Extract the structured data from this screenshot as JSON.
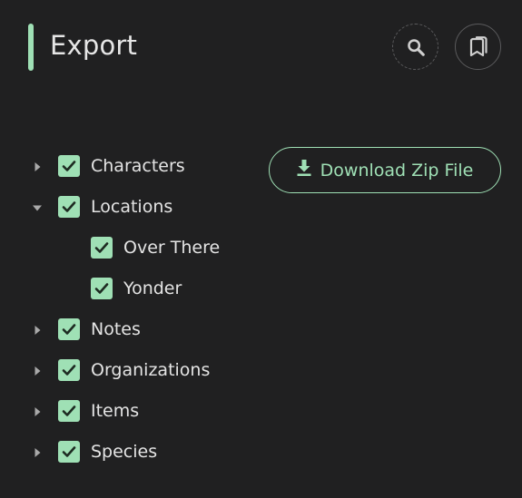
{
  "colors": {
    "accent": "#9fe0b5",
    "background": "#202021",
    "text": "#e4e4e4",
    "icon": "#cfcfcf",
    "check_mark": "#1d2a21"
  },
  "header": {
    "title": "Export",
    "search_icon": "search-icon",
    "bookmark_icon": "bookmarks-icon"
  },
  "download": {
    "label": "Download Zip File",
    "icon": "download-icon"
  },
  "tree": [
    {
      "label": "Characters",
      "checked": true,
      "expanded": false,
      "level": 0
    },
    {
      "label": "Locations",
      "checked": true,
      "expanded": true,
      "level": 0
    },
    {
      "label": "Over There",
      "checked": true,
      "level": 1
    },
    {
      "label": "Yonder",
      "checked": true,
      "level": 1
    },
    {
      "label": "Notes",
      "checked": true,
      "expanded": false,
      "level": 0
    },
    {
      "label": "Organizations",
      "checked": true,
      "expanded": false,
      "level": 0
    },
    {
      "label": "Items",
      "checked": true,
      "expanded": false,
      "level": 0
    },
    {
      "label": "Species",
      "checked": true,
      "expanded": false,
      "level": 0
    }
  ]
}
